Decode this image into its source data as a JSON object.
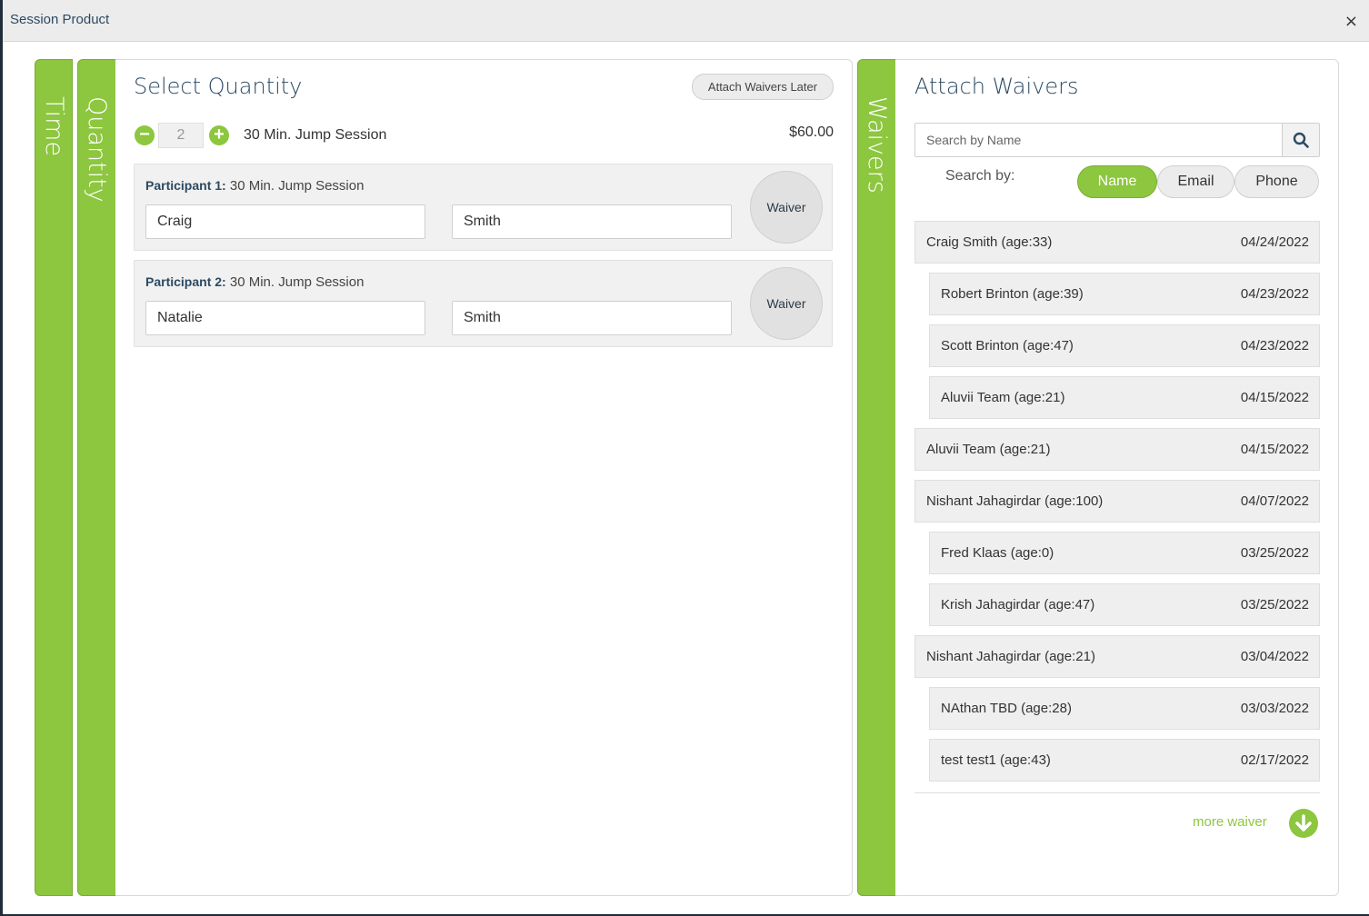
{
  "modal": {
    "title": "Session Product",
    "close_label": "×"
  },
  "tabs": {
    "time": "Time",
    "quantity": "Quantity",
    "waivers": "Waivers"
  },
  "quantity_panel": {
    "title": "Select Quantity",
    "attach_later_label": "Attach Waivers Later",
    "minus_label": "−",
    "plus_label": "+",
    "quantity": "2",
    "product_name": "30 Min. Jump Session",
    "price": "$60.00",
    "participants": [
      {
        "label": "Participant 1:",
        "session": "30 Min. Jump Session",
        "first_name": "Craig",
        "last_name": "Smith",
        "waiver_label": "Waiver"
      },
      {
        "label": "Participant 2:",
        "session": "30 Min. Jump Session",
        "first_name": "Natalie",
        "last_name": "Smith",
        "waiver_label": "Waiver"
      }
    ]
  },
  "waivers_panel": {
    "title": "Attach Waivers",
    "search_placeholder": "Search by Name",
    "search_by_label": "Search by:",
    "search_options": [
      "Name",
      "Email",
      "Phone"
    ],
    "selected_option": "Name",
    "waivers": [
      {
        "name": "Craig Smith (age:33)",
        "date": "04/24/2022",
        "nested": false
      },
      {
        "name": "Robert Brinton (age:39)",
        "date": "04/23/2022",
        "nested": true
      },
      {
        "name": "Scott Brinton (age:47)",
        "date": "04/23/2022",
        "nested": true
      },
      {
        "name": "Aluvii Team (age:21)",
        "date": "04/15/2022",
        "nested": true
      },
      {
        "name": "Aluvii Team (age:21)",
        "date": "04/15/2022",
        "nested": false
      },
      {
        "name": "Nishant Jahagirdar (age:100)",
        "date": "04/07/2022",
        "nested": false
      },
      {
        "name": "Fred Klaas (age:0)",
        "date": "03/25/2022",
        "nested": true
      },
      {
        "name": "Krish Jahagirdar (age:47)",
        "date": "03/25/2022",
        "nested": true
      },
      {
        "name": "Nishant Jahagirdar (age:21)",
        "date": "03/04/2022",
        "nested": false
      },
      {
        "name": "NAthan TBD (age:28)",
        "date": "03/03/2022",
        "nested": true
      },
      {
        "name": "test test1 (age:43)",
        "date": "02/17/2022",
        "nested": true
      }
    ],
    "more_label": "more waiver"
  },
  "colors": {
    "accent": "#8dc63f",
    "title": "#2b4a63"
  },
  "icons": {
    "search": "search-icon",
    "more": "arrow-down-circle-icon"
  }
}
